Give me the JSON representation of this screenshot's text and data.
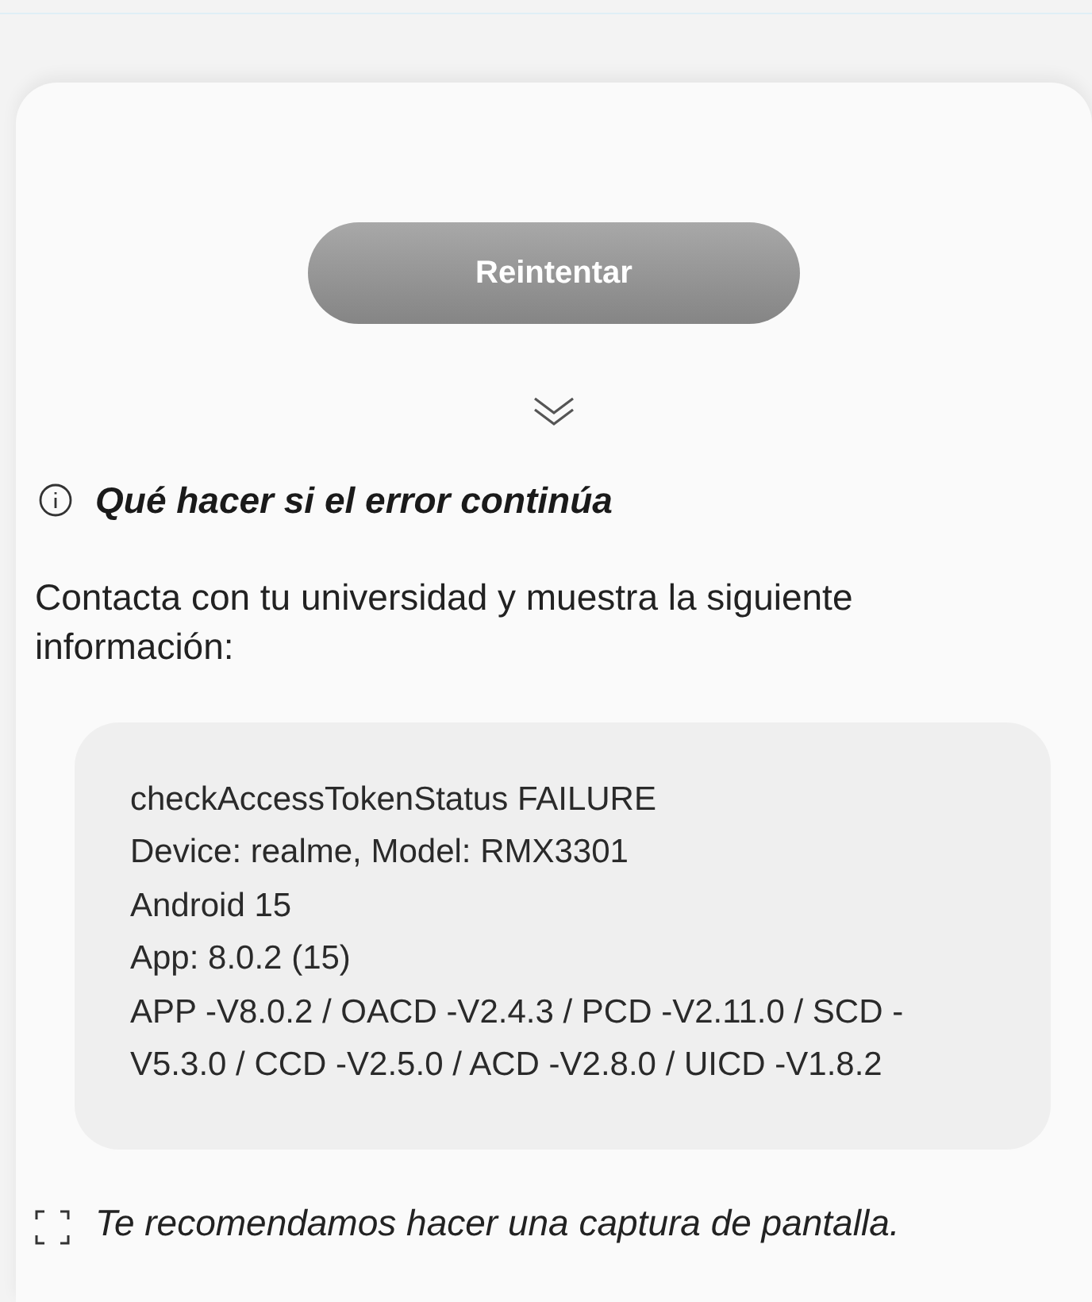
{
  "retry_button": {
    "label": "Reintentar",
    "disabled": true
  },
  "help": {
    "heading": "Qué hacer si el error continúa",
    "expanded": true,
    "text": "Contacta con tu universidad y muestra la siguiente información:",
    "details": [
      "checkAccessTokenStatus FAILURE",
      "Device: realme, Model: RMX3301",
      "Android 15",
      "App: 8.0.2 (15)",
      "APP -V8.0.2 / OACD -V2.4.3 / PCD -V2.11.0 / SCD -V5.3.0 / CCD -V2.5.0 / ACD -V2.8.0 / UICD -V1.8.2"
    ],
    "note": "Te recomendamos hacer una captura de pantalla."
  }
}
